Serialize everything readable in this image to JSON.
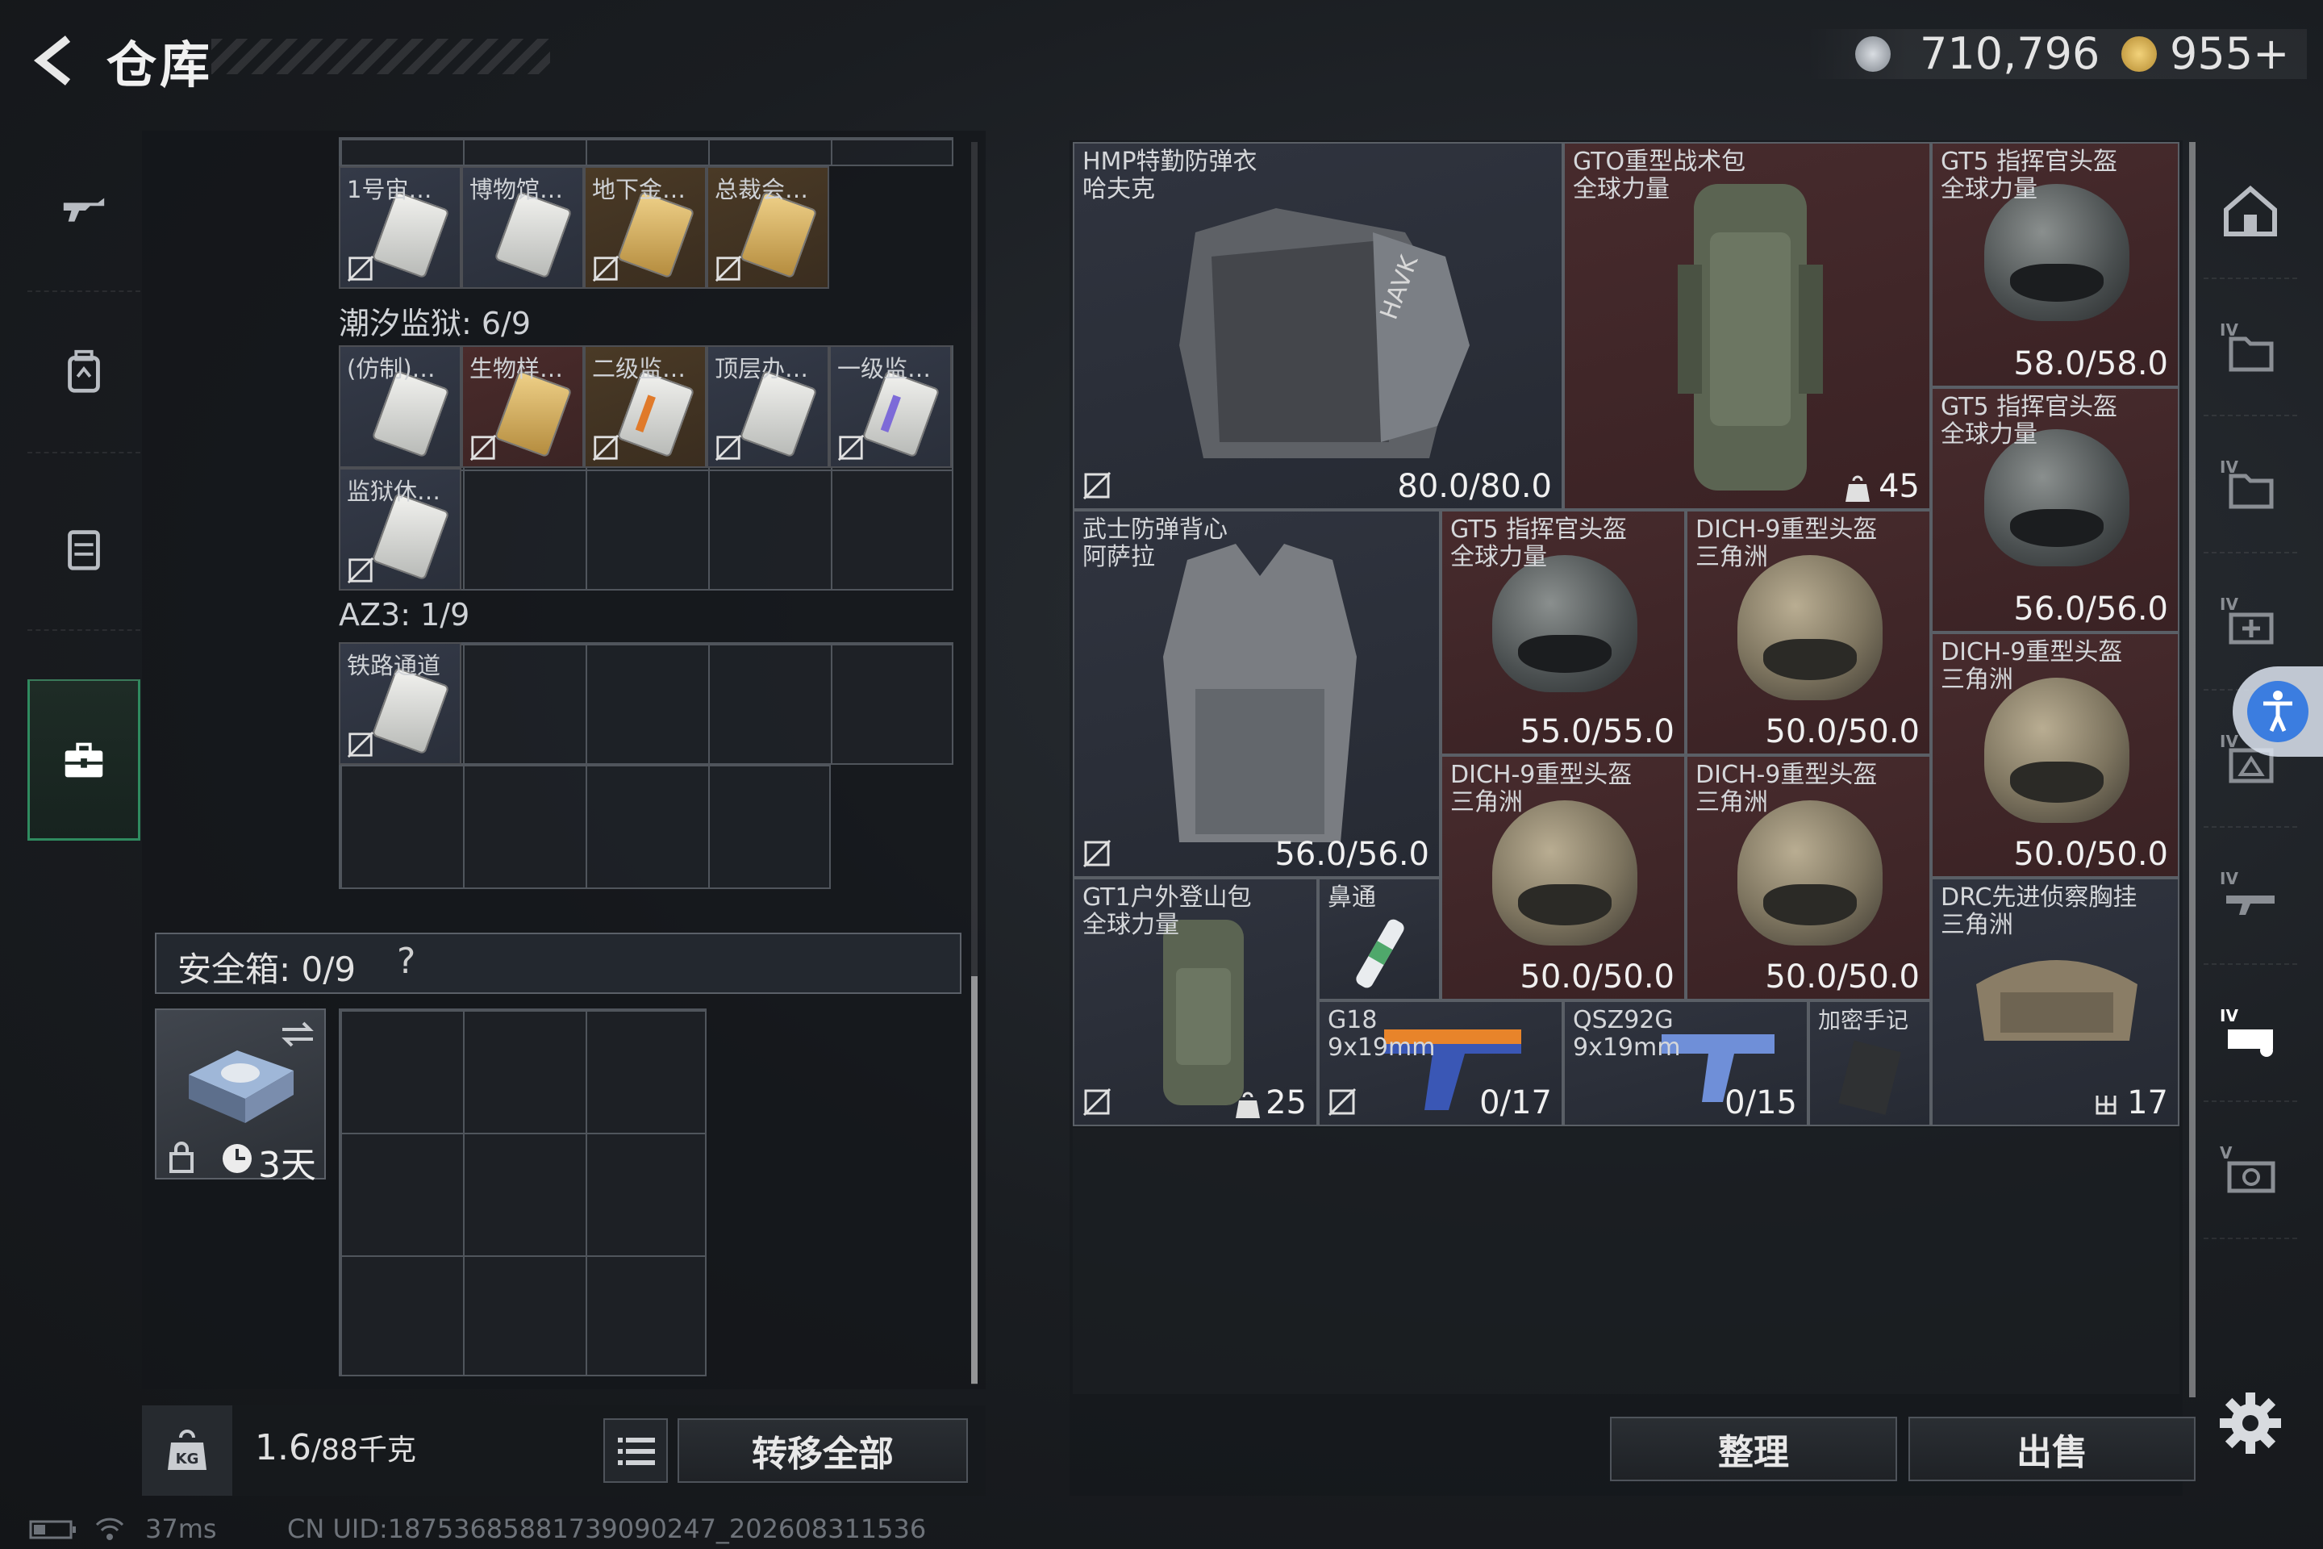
{
  "header": {
    "title": "仓库"
  },
  "currency": {
    "coins": "710,796",
    "premium": "955+"
  },
  "left_grid": {
    "row_labels": [
      "1号宙…",
      "博物馆…",
      "地下金…",
      "总裁会…"
    ],
    "section_tidal": "潮汐监狱: 6/9",
    "tidal_labels": [
      "(仿制)…",
      "生物样…",
      "二级监…",
      "顶层办…",
      "一级监…",
      "监狱休…"
    ],
    "section_az3": "AZ3: 1/9",
    "az3_labels": [
      "铁路通道"
    ]
  },
  "safe": {
    "label": "安全箱: 0/9",
    "help": "?",
    "timer": "3天"
  },
  "weight": {
    "current": "1.6",
    "max": "/88千克"
  },
  "buttons": {
    "transfer_all": "转移全部",
    "sort": "整理",
    "sell": "出售"
  },
  "stash": {
    "hmp": {
      "name1": "HMP特勤防弹衣",
      "name2": "哈夫克",
      "dur": "80.0/80.0"
    },
    "gto": {
      "name1": "GTO重型战术包",
      "name2": "全球力量",
      "cnt": "45"
    },
    "gt5a": {
      "name1": "GT5 指挥官头盔",
      "name2": "全球力量",
      "dur": "58.0/58.0"
    },
    "gt5b": {
      "name1": "GT5 指挥官头盔",
      "name2": "全球力量",
      "dur": "56.0/56.0"
    },
    "samurai": {
      "name1": "武士防弹背心",
      "name2": "阿萨拉",
      "dur": "56.0/56.0"
    },
    "gt5c": {
      "name1": "GT5 指挥官头盔",
      "name2": "全球力量",
      "dur": "55.0/55.0"
    },
    "dich1": {
      "name1": "DICH-9重型头盔",
      "name2": "三角洲",
      "dur": "50.0/50.0"
    },
    "dich2": {
      "name1": "DICH-9重型头盔",
      "name2": "三角洲",
      "dur": "50.0/50.0"
    },
    "dich3": {
      "name1": "DICH-9重型头盔",
      "name2": "三角洲",
      "dur": "50.0/50.0"
    },
    "dich4": {
      "name1": "DICH-9重型头盔",
      "name2": "三角洲",
      "dur": "50.0/50.0"
    },
    "gt1": {
      "name1": "GT1户外登山包",
      "name2": "全球力量",
      "cnt": "25"
    },
    "nasal": {
      "name1": "鼻通"
    },
    "g18": {
      "name1": "G18",
      "name2": "9x19mm",
      "ammo": "0/17"
    },
    "qsz": {
      "name1": "QSZ92G",
      "name2": "9x19mm",
      "ammo": "0/15"
    },
    "notes": {
      "name1": "加密手记"
    },
    "drc": {
      "name1": "DRC先进侦察胸挂",
      "name2": "三角洲",
      "cnt": "17"
    }
  },
  "status_bar": {
    "ping": "37ms",
    "uid": "CN UID:18753685881739090247_202608311536"
  },
  "colors": {
    "accent_green": "#2f8b5f",
    "item_red": "#472b2d",
    "item_blue": "#30343f",
    "access_blue": "#3b7de0"
  }
}
